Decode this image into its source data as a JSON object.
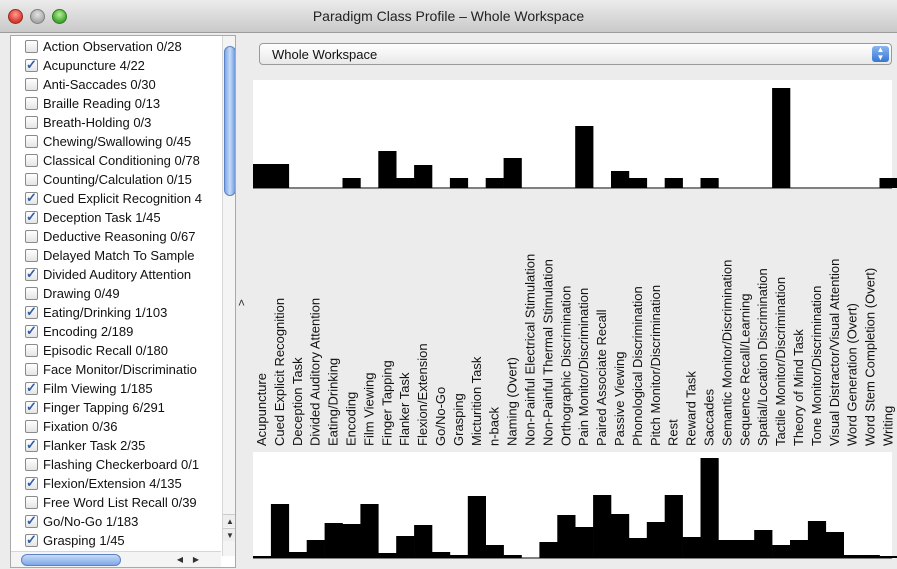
{
  "window": {
    "title": "Paradigm Class Profile – Whole Workspace"
  },
  "selector": {
    "value": "Whole Workspace"
  },
  "sidebar": {
    "items": [
      {
        "label": "Action Observation 0/28",
        "checked": false
      },
      {
        "label": "Acupuncture 4/22",
        "checked": true
      },
      {
        "label": "Anti-Saccades 0/30",
        "checked": false
      },
      {
        "label": "Braille Reading 0/13",
        "checked": false
      },
      {
        "label": "Breath-Holding 0/3",
        "checked": false
      },
      {
        "label": "Chewing/Swallowing 0/45",
        "checked": false
      },
      {
        "label": "Classical Conditioning 0/78",
        "checked": false
      },
      {
        "label": "Counting/Calculation 0/15",
        "checked": false
      },
      {
        "label": "Cued Explicit Recognition 4",
        "checked": true
      },
      {
        "label": "Deception Task 1/45",
        "checked": true
      },
      {
        "label": "Deductive Reasoning 0/67",
        "checked": false
      },
      {
        "label": "Delayed Match To Sample",
        "checked": false
      },
      {
        "label": "Divided Auditory Attention",
        "checked": true
      },
      {
        "label": "Drawing 0/49",
        "checked": false
      },
      {
        "label": "Eating/Drinking 1/103",
        "checked": true
      },
      {
        "label": "Encoding 2/189",
        "checked": true
      },
      {
        "label": "Episodic Recall 0/180",
        "checked": false
      },
      {
        "label": "Face Monitor/Discriminatio",
        "checked": false
      },
      {
        "label": "Film Viewing 1/185",
        "checked": true
      },
      {
        "label": "Finger Tapping 6/291",
        "checked": true
      },
      {
        "label": "Fixation 0/36",
        "checked": false
      },
      {
        "label": "Flanker Task 2/35",
        "checked": true
      },
      {
        "label": "Flashing Checkerboard 0/1",
        "checked": false
      },
      {
        "label": "Flexion/Extension 4/135",
        "checked": true
      },
      {
        "label": "Free Word List Recall 0/39",
        "checked": false
      },
      {
        "label": "Go/No-Go 1/183",
        "checked": true
      },
      {
        "label": "Grasping 1/45",
        "checked": true
      }
    ]
  },
  "chart_data": [
    {
      "type": "bar",
      "categories": [
        "Acupuncture",
        "Cued Explicit Recognition",
        "Deception Task",
        "Divided Auditory Attention",
        "Eating/Drinking",
        "Encoding",
        "Film Viewing",
        "Finger Tapping",
        "Flanker Task",
        "Flexion/Extension",
        "Go/No-Go",
        "Grasping",
        "Micturition Task",
        "n-back",
        "Naming (Overt)",
        "Non-Painful Electrical Stimulation",
        "Non-Painful Thermal Stimulation",
        "Orthographic Discrimination",
        "Pain Monitor/Discrimination",
        "Paired Associate Recall",
        "Passive Viewing",
        "Phonological Discrimination",
        "Pitch Monitor/Discrimination",
        "Rest",
        "Reward Task",
        "Saccades",
        "Semantic Monitor/Discrimination",
        "Sequence Recall/Learning",
        "Spatial/Location Discrimination",
        "Tactile Monitor/Discrimination",
        "Theory of Mind Task",
        "Tone Monitor/Discrimination",
        "Visual Distractor/Visual Attention",
        "Word Generation (Overt)",
        "Word Stem Completion (Overt)",
        "Writing"
      ],
      "values": [
        24,
        24,
        0,
        0,
        0,
        10,
        0,
        37,
        10,
        23,
        0,
        10,
        0,
        10,
        30,
        0,
        0,
        0,
        62,
        0,
        17,
        10,
        0,
        10,
        0,
        10,
        0,
        0,
        0,
        100,
        0,
        0,
        0,
        0,
        0,
        10
      ],
      "ylim": [
        0,
        100
      ]
    },
    {
      "type": "bar",
      "categories": [
        "Acupuncture",
        "Cued Explicit Recognition",
        "Deception Task",
        "Divided Auditory Attention",
        "Eating/Drinking",
        "Encoding",
        "Film Viewing",
        "Finger Tapping",
        "Flanker Task",
        "Flexion/Extension",
        "Go/No-Go",
        "Grasping",
        "Micturition Task",
        "n-back",
        "Naming (Overt)",
        "Non-Painful Electrical Stimulation",
        "Non-Painful Thermal Stimulation",
        "Orthographic Discrimination",
        "Pain Monitor/Discrimination",
        "Paired Associate Recall",
        "Passive Viewing",
        "Phonological Discrimination",
        "Pitch Monitor/Discrimination",
        "Rest",
        "Reward Task",
        "Saccades",
        "Semantic Monitor/Discrimination",
        "Sequence Recall/Learning",
        "Spatial/Location Discrimination",
        "Tactile Monitor/Discrimination",
        "Theory of Mind Task",
        "Tone Monitor/Discrimination",
        "Visual Distractor/Visual Attention",
        "Word Generation (Overt)",
        "Word Stem Completion (Overt)",
        "Writing"
      ],
      "values": [
        2,
        54,
        6,
        18,
        35,
        34,
        54,
        5,
        22,
        33,
        6,
        3,
        62,
        13,
        3,
        0,
        16,
        43,
        31,
        63,
        44,
        20,
        36,
        63,
        21,
        100,
        18,
        18,
        28,
        13,
        18,
        37,
        26,
        3,
        3,
        2
      ],
      "ylim": [
        0,
        100
      ]
    }
  ]
}
